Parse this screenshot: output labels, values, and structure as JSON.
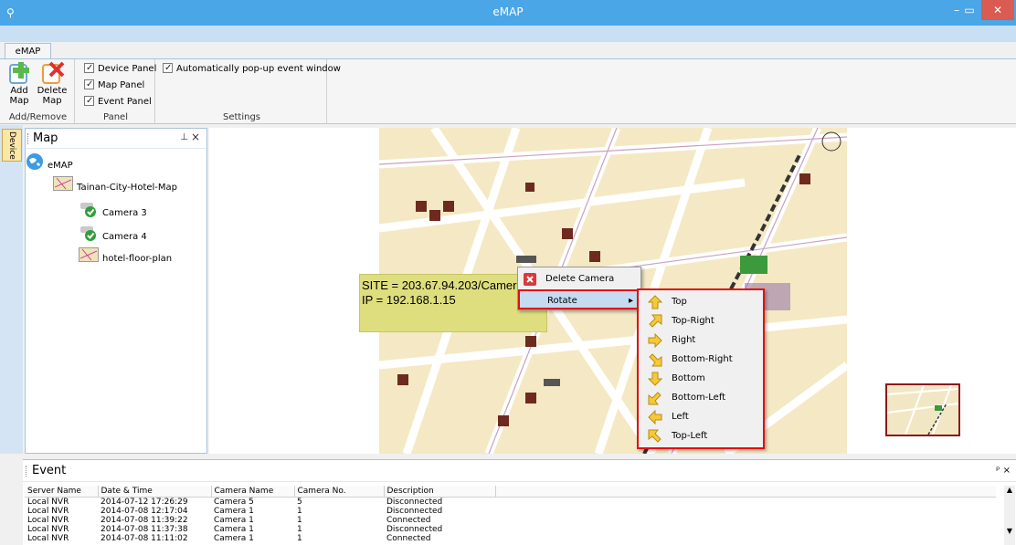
{
  "window": {
    "title": "eMAP",
    "min": "–",
    "max": "▭",
    "close": "✕"
  },
  "ribbon": {
    "tab": "eMAP",
    "add_remove": {
      "add_label": "Add\nMap",
      "delete_label": "Delete\nMap",
      "group_label": "Add/Remove"
    },
    "panel": {
      "device": "Device Panel",
      "map": "Map Panel",
      "event": "Event Panel",
      "group_label": "Panel"
    },
    "settings": {
      "popup": "Automatically pop-up event window",
      "group_label": "Settings"
    }
  },
  "side_tab": "Device",
  "map_panel": {
    "title": "Map",
    "pin": "ᵖ",
    "tree": [
      {
        "label": "eMAP",
        "icon": "globe-icon"
      },
      {
        "label": "Tainan-City-Hotel-Map",
        "icon": "map-thumbnail-icon"
      },
      {
        "label": "Camera 3",
        "icon": "camera-check-icon"
      },
      {
        "label": "Camera 4",
        "icon": "camera-check-icon"
      },
      {
        "label": "hotel-floor-plan",
        "icon": "map-thumbnail-icon"
      }
    ]
  },
  "overlay": {
    "site": "SITE = 203.67.94.203/Camer",
    "ip": "IP = 192.168.1.15"
  },
  "context_menu": {
    "delete": "Delete Camera",
    "rotate": "Rotate"
  },
  "rotate_menu": [
    "Top",
    "Top-Right",
    "Right",
    "Bottom-Right",
    "Bottom",
    "Bottom-Left",
    "Left",
    "Top-Left"
  ],
  "event_panel": {
    "title": "Event",
    "columns": [
      "Server Name",
      "Date & Time",
      "Camera Name",
      "Camera No.",
      "Description"
    ],
    "rows": [
      [
        "Local NVR",
        "2014-07-12 17:26:29",
        "Camera 5",
        "5",
        "Disconnected"
      ],
      [
        "Local NVR",
        "2014-07-08 12:17:04",
        "Camera 1",
        "1",
        "Disconnected"
      ],
      [
        "Local NVR",
        "2014-07-08 11:39:22",
        "Camera 1",
        "1",
        "Connected"
      ],
      [
        "Local NVR",
        "2014-07-08 11:37:38",
        "Camera 1",
        "1",
        "Disconnected"
      ],
      [
        "Local NVR",
        "2014-07-08 11:11:02",
        "Camera 1",
        "1",
        "Connected"
      ]
    ]
  },
  "colors": {
    "titlebar": "#4aa6e6",
    "close": "#d95b52",
    "highlight_border": "#e01010",
    "tooltip_bg": "#dede7e"
  }
}
